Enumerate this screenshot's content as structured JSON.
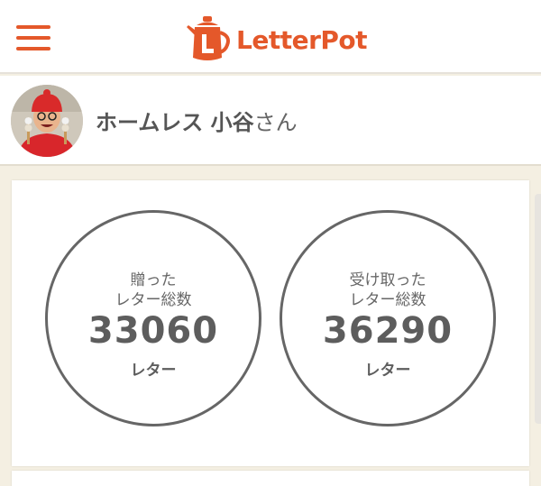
{
  "header": {
    "logo_text": "LetterPot",
    "logo_icon": "teapot-letter-icon",
    "menu_icon": "hamburger-menu-icon",
    "accent_color": "#e4582a"
  },
  "profile": {
    "name": "ホームレス 小谷",
    "honorific": "さん",
    "avatar_icon": "user-avatar"
  },
  "stats": {
    "sent": {
      "label": "贈った\nレター総数",
      "count": "33060",
      "unit": "レター"
    },
    "received": {
      "label": "受け取った\nレター総数",
      "count": "36290",
      "unit": "レター"
    }
  }
}
